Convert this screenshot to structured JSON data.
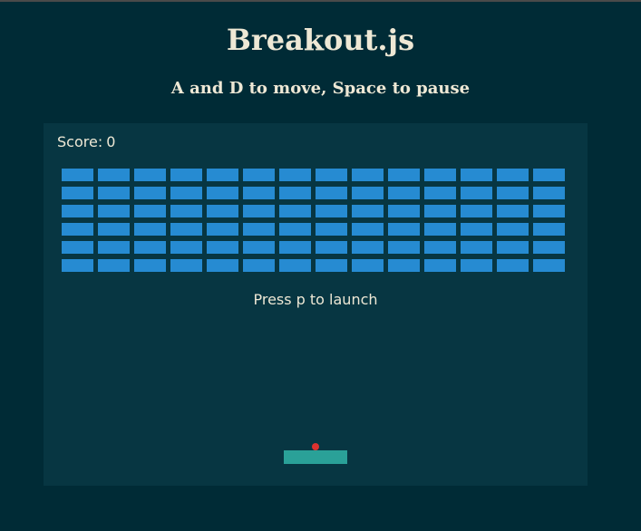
{
  "header": {
    "title": "Breakout.js",
    "instructions": "A and D to move, Space to pause"
  },
  "game": {
    "score_label": "Score:",
    "score": "0",
    "message": "Press p to launch",
    "brick_rows": 6,
    "brick_cols": 14,
    "colors": {
      "page_background": "#002b36",
      "board_background": "#073642",
      "text": "#eee8d5",
      "brick": "#268bd2",
      "paddle": "#2aa198",
      "ball": "#dc322f"
    }
  }
}
